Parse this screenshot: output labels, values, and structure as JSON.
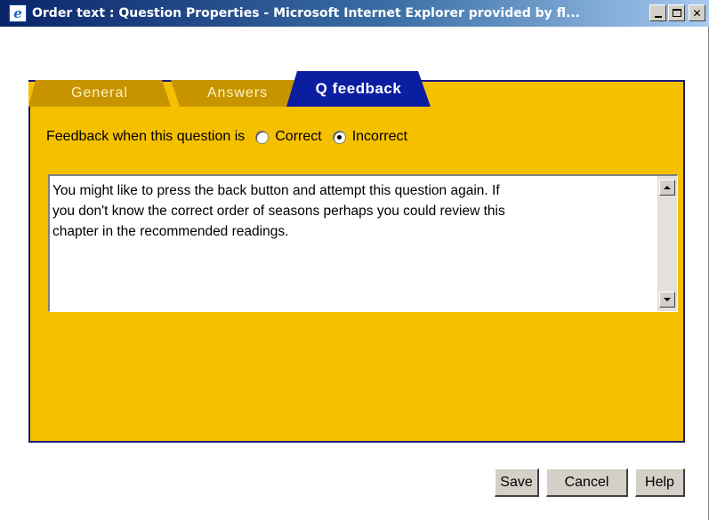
{
  "window": {
    "title": "Order text : Question Properties - Microsoft Internet Explorer provided by fl...",
    "app_icon": "ie-icon",
    "controls": {
      "minimize": "minimize-icon",
      "maximize": "maximize-icon",
      "close": "close-icon"
    }
  },
  "tabs": [
    {
      "label": "General",
      "active": false
    },
    {
      "label": "Answers",
      "active": false
    },
    {
      "label": "Q feedback",
      "active": true
    }
  ],
  "feedback": {
    "prompt": "Feedback when this question is",
    "options": [
      {
        "label": "Correct",
        "checked": false
      },
      {
        "label": "Incorrect",
        "checked": true
      }
    ],
    "text": "You might like to press the back button and attempt this question again. If\nyou don't know the correct order of seasons perhaps you could review this\nchapter in the recommended readings."
  },
  "buttons": {
    "save": "Save",
    "cancel": "Cancel",
    "help": "Help"
  },
  "colors": {
    "panel": "#f5c000",
    "active_tab": "#0b1ea0",
    "inactive_tab": "#c79400",
    "border": "#1b1b7a"
  }
}
